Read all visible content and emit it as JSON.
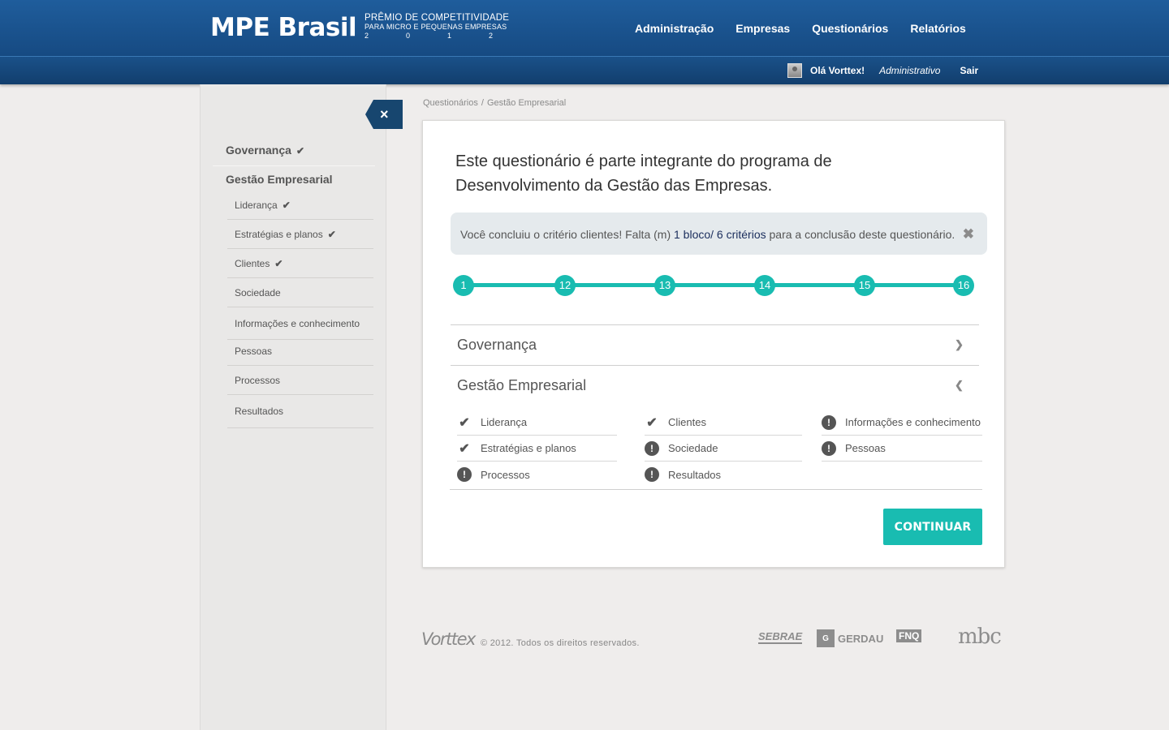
{
  "header": {
    "logo": "MPE Brasil",
    "tagline_1": "PRÊMIO DE COMPETITIVIDADE",
    "tagline_2": "PARA MICRO E PEQUENAS EMPRESAS",
    "year_digits": [
      "2",
      "0",
      "1",
      "2"
    ],
    "nav": [
      "Administração",
      "Empresas",
      "Questionários",
      "Relatórios"
    ],
    "greeting": "Olá  Vorttex!",
    "role": "Administrativo",
    "logout": "Sair"
  },
  "sidebar": {
    "close_icon": "×",
    "groups": [
      {
        "label": "Governança",
        "checked": true
      },
      {
        "label": "Gestão Empresarial",
        "checked": false
      }
    ],
    "items": [
      {
        "label": "Liderança",
        "checked": true
      },
      {
        "label": "Estratégias e planos",
        "checked": true
      },
      {
        "label": "Clientes",
        "checked": true
      },
      {
        "label": "Sociedade",
        "checked": false
      },
      {
        "label": "Informações e conhecimento",
        "checked": false
      },
      {
        "label": "Pessoas",
        "checked": false
      },
      {
        "label": "Processos",
        "checked": false
      },
      {
        "label": "Resultados",
        "checked": false
      }
    ]
  },
  "breadcrumb": [
    "Questionários",
    "/",
    "Gestão Empresarial"
  ],
  "card": {
    "intro_line1": "Este questionário é parte integrante do programa de",
    "intro_line2": "Desenvolvimento da Gestão das Empresas.",
    "alert_prefix": "Você concluiu o critério clientes! Falta (m) ",
    "alert_highlight": "1 bloco/ 6 critérios",
    "alert_suffix": " para a conclusão deste questionário.",
    "alert_close": "✖",
    "steps": [
      "1",
      "12",
      "13",
      "14",
      "15",
      "16"
    ],
    "accordion": [
      {
        "title": "Governança",
        "chevron": "⌄",
        "expanded": false
      },
      {
        "title": "Gestão Empresarial",
        "chevron": "⌃",
        "expanded": true
      }
    ],
    "criteria": [
      {
        "label": "Liderança",
        "status": "done"
      },
      {
        "label": "Clientes",
        "status": "done"
      },
      {
        "label": "Informações e conhecimento",
        "status": "pending"
      },
      {
        "label": "Estratégias e planos",
        "status": "done"
      },
      {
        "label": "Sociedade",
        "status": "pending"
      },
      {
        "label": "Pessoas",
        "status": "pending"
      },
      {
        "label": "Processos",
        "status": "pending"
      },
      {
        "label": "Resultados",
        "status": "pending"
      }
    ],
    "continue_label": "CONTINUAR"
  },
  "footer": {
    "vortex": "Vorttex",
    "copyright": "© 2012. Todos os direitos reservados.",
    "sebrae": "SEBRAE",
    "gerdau_box": "G",
    "gerdau": "GERDAU",
    "fnq": "FNQ",
    "mbc": "mbc"
  },
  "colors": {
    "accent": "#19bcb1",
    "header": "#1f5d9c",
    "sidebar_close": "#17466f"
  }
}
